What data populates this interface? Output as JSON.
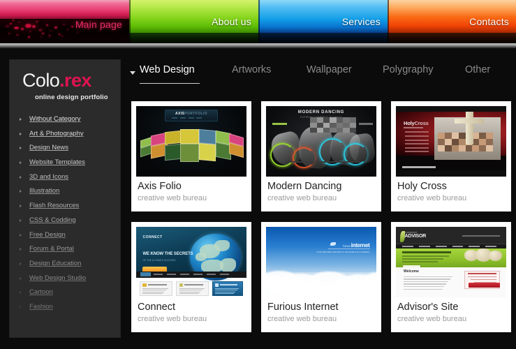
{
  "topnav": {
    "tabs": [
      {
        "label": "Main page",
        "id": "main-page",
        "accent": "#e62e63"
      },
      {
        "label": "About us",
        "id": "about-us",
        "accent": "#85d41c"
      },
      {
        "label": "Services",
        "id": "services",
        "accent": "#139fe8"
      },
      {
        "label": "Contacts",
        "id": "contacts",
        "accent": "#fa6a14"
      }
    ]
  },
  "sidebar": {
    "logo": {
      "part1": "Colo",
      "part2": ".rex",
      "tagline": "online design portfolio"
    },
    "menu": [
      {
        "label": "Without Category"
      },
      {
        "label": "Art & Photography"
      },
      {
        "label": "Design News"
      },
      {
        "label": "Website Templates"
      },
      {
        "label": "3D and Icons"
      },
      {
        "label": "Illustration"
      },
      {
        "label": "Flash Resources"
      },
      {
        "label": "CSS & Codding"
      },
      {
        "label": "Free Design"
      },
      {
        "label": "Forum & Portal"
      },
      {
        "label": "Design Education"
      },
      {
        "label": "Web Design Studio"
      },
      {
        "label": "Cartoon"
      },
      {
        "label": "Fashion"
      }
    ]
  },
  "subtabs": {
    "items": [
      {
        "label": "Web Design",
        "active": true
      },
      {
        "label": "Artworks",
        "active": false
      },
      {
        "label": "Wallpaper",
        "active": false
      },
      {
        "label": "Polygraphy",
        "active": false
      },
      {
        "label": "Other",
        "active": false
      }
    ]
  },
  "gallery": {
    "subtitle_common": "creative web bureau",
    "cards": [
      {
        "title": "Axis Folio",
        "subtitle": "creative web bureau",
        "art": "axis",
        "headline": "AXISPORTFOLIO"
      },
      {
        "title": "Modern Dancing",
        "subtitle": "creative web bureau",
        "art": "dancing",
        "headline": "MODERN DANCING",
        "sub_headline": "EXPRESS YOURSELF IN DANCE"
      },
      {
        "title": "Holy Cross",
        "subtitle": "creative web bureau",
        "art": "cross",
        "headline": "HolyCross"
      },
      {
        "title": "Connect",
        "subtitle": "creative web bureau",
        "art": "connect",
        "headline": "CONNECT",
        "hero_line1": "WE KNOW THE SECRETS",
        "hero_line2": "OF THE ULTIMATE SUCCESS"
      },
      {
        "title": "Furious Internet",
        "subtitle": "creative web bureau",
        "art": "furious",
        "headline": "internet",
        "sub_headline": "furious"
      },
      {
        "title": "Advisor's Site",
        "subtitle": "creative web bureau",
        "art": "advisor",
        "headline": "ADVISOR",
        "sub_headline": "investment",
        "welcome": "Welcome"
      }
    ]
  }
}
